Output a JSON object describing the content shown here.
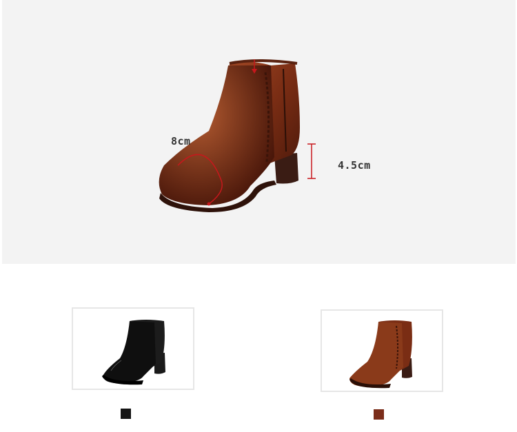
{
  "dimensions": {
    "circumference": "8cm",
    "heel_height": "4.5cm"
  },
  "colors": {
    "accent_red": "#c8171c",
    "brown_leather": "#7a2d14",
    "black_leather": "#151515",
    "swatch_black": "#141414",
    "swatch_brown": "#7b2d1a"
  },
  "variants": [
    {
      "name": "black",
      "color": "#141414"
    },
    {
      "name": "brown",
      "color": "#7b2d1a"
    }
  ]
}
